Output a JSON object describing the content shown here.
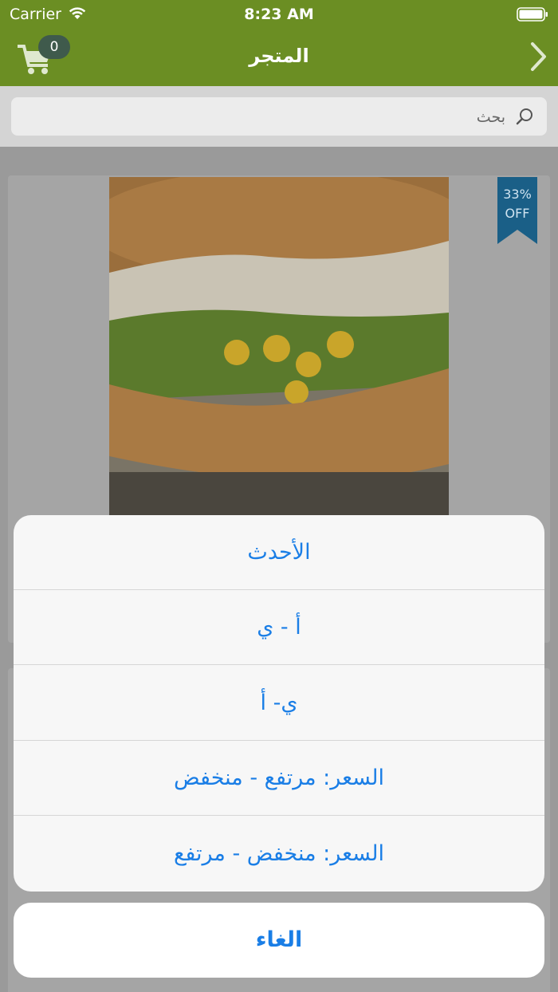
{
  "status_bar": {
    "carrier": "Carrier",
    "time": "8:23 AM"
  },
  "nav": {
    "title": "المتجر",
    "cart_count": "0"
  },
  "search": {
    "placeholder": "بحث"
  },
  "product": {
    "sale_percent": "33%",
    "sale_off": "OFF"
  },
  "sort_sheet": {
    "options": [
      {
        "label": "الأحدث"
      },
      {
        "label": "أ - ي"
      },
      {
        "label": "ي- أ"
      },
      {
        "label": "السعر: مرتفع - منخفض"
      },
      {
        "label": "السعر: منخفض - مرتفع"
      }
    ],
    "cancel_label": "الغاء"
  },
  "colors": {
    "brand": "#6b8e23",
    "action_blue": "#1a7ee6",
    "ribbon": "#1d8ac9"
  }
}
